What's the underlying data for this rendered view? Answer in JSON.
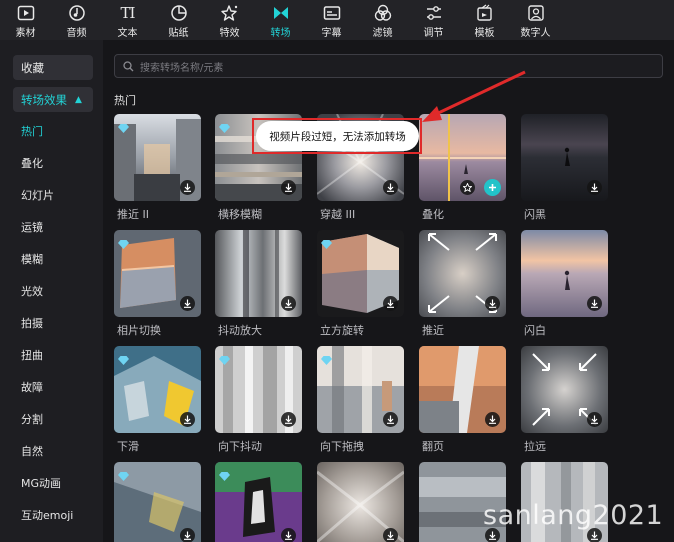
{
  "toolbar": {
    "items": [
      {
        "label": "素材",
        "icon": "media-icon"
      },
      {
        "label": "音频",
        "icon": "audio-icon"
      },
      {
        "label": "文本",
        "icon": "text-icon"
      },
      {
        "label": "贴纸",
        "icon": "sticker-icon"
      },
      {
        "label": "特效",
        "icon": "effects-icon"
      },
      {
        "label": "转场",
        "icon": "transition-icon"
      },
      {
        "label": "字幕",
        "icon": "subtitle-icon"
      },
      {
        "label": "滤镜",
        "icon": "filter-icon"
      },
      {
        "label": "调节",
        "icon": "adjust-icon"
      },
      {
        "label": "模板",
        "icon": "template-icon"
      },
      {
        "label": "数字人",
        "icon": "digital-human-icon"
      }
    ],
    "active_index": 5,
    "text_icon_glyph": "TI"
  },
  "sidebar": {
    "favorites": "收藏",
    "category": "转场效果",
    "items": [
      "热门",
      "叠化",
      "幻灯片",
      "运镜",
      "模糊",
      "光效",
      "拍摄",
      "扭曲",
      "故障",
      "分割",
      "自然",
      "MG动画",
      "互动emoji"
    ],
    "active_item": "热门"
  },
  "search": {
    "placeholder": "搜索转场名称/元素"
  },
  "section_title": "热门",
  "tooltip": "视频片段过短，无法添加转场",
  "watermark": "sanlang2021",
  "cards": [
    {
      "label": "推近 II"
    },
    {
      "label": "横移模糊"
    },
    {
      "label": "穿越 III"
    },
    {
      "label": "叠化"
    },
    {
      "label": "闪黑"
    },
    {
      "label": "相片切换"
    },
    {
      "label": "抖动放大"
    },
    {
      "label": "立方旋转"
    },
    {
      "label": "推近"
    },
    {
      "label": "闪白"
    },
    {
      "label": "下滑"
    },
    {
      "label": "向下抖动"
    },
    {
      "label": "向下拖拽"
    },
    {
      "label": "翻页"
    },
    {
      "label": "拉远"
    },
    {
      "label": ""
    },
    {
      "label": ""
    },
    {
      "label": ""
    },
    {
      "label": ""
    },
    {
      "label": ""
    }
  ],
  "colors": {
    "accent": "#22d3d6",
    "annotation": "#e02a2a"
  }
}
